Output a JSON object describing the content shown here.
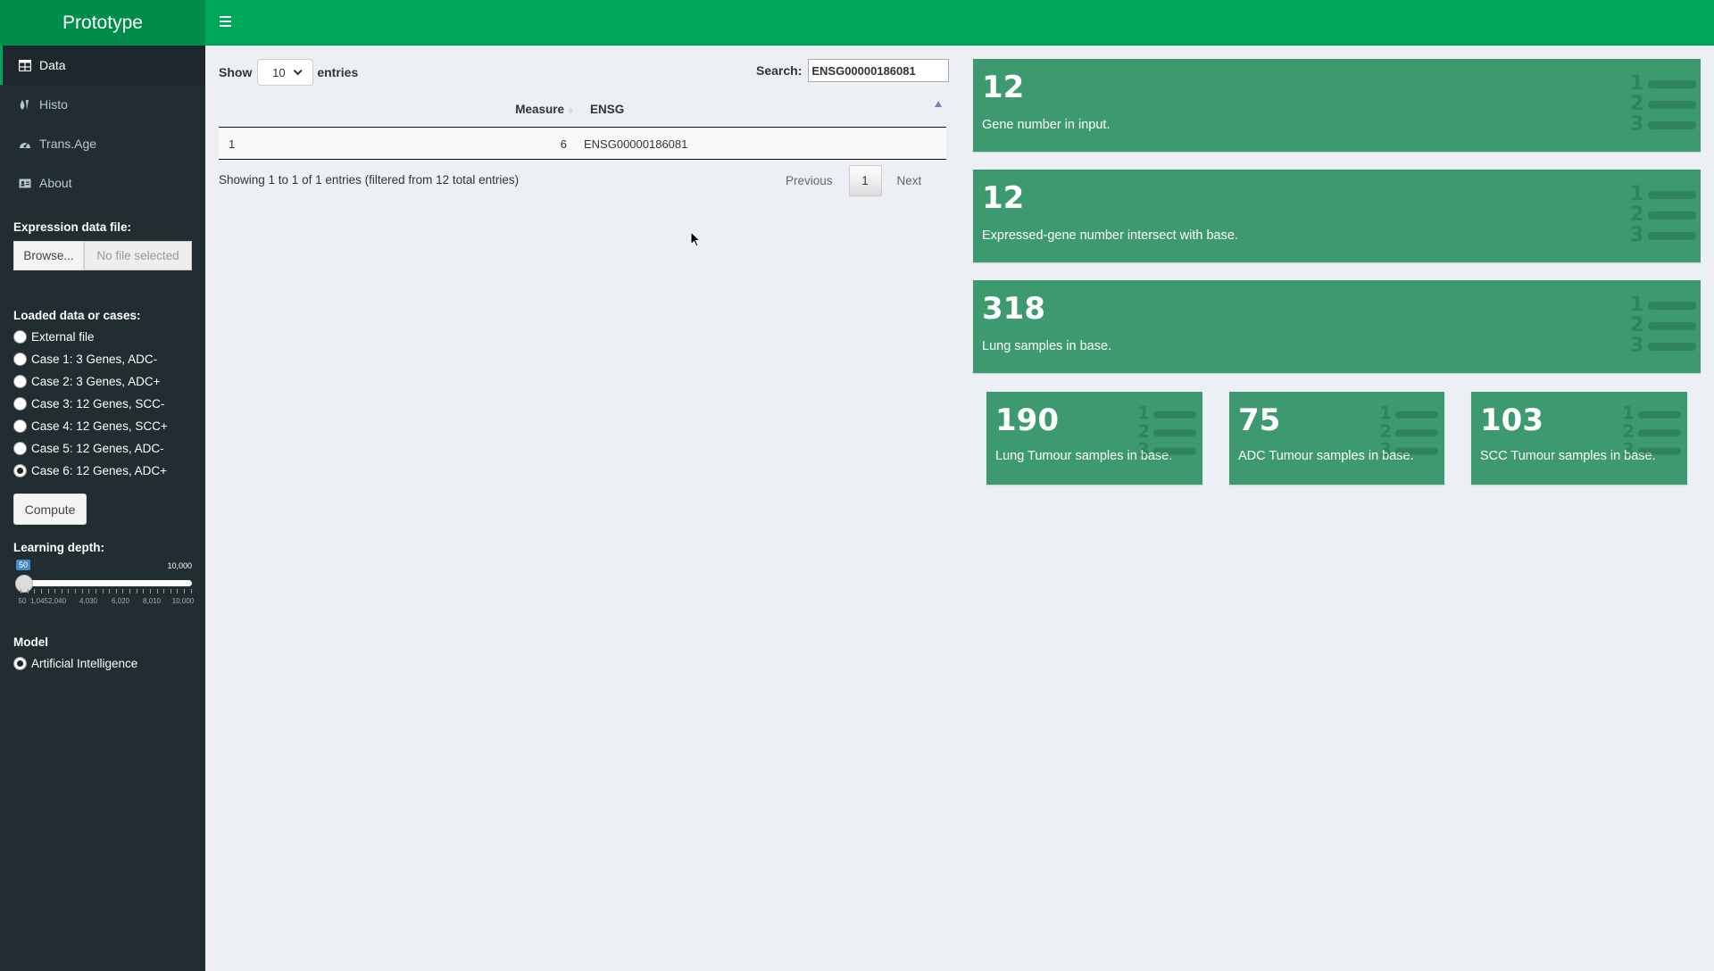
{
  "app": {
    "title": "Prototype"
  },
  "sidebar": {
    "menu": [
      {
        "label": "Data",
        "icon": "table-icon"
      },
      {
        "label": "Histo",
        "icon": "tint-icon"
      },
      {
        "label": "Trans.Age",
        "icon": "dashboard-icon"
      },
      {
        "label": "About",
        "icon": "id-card-icon"
      }
    ],
    "file_input": {
      "label": "Expression data file:",
      "button": "Browse...",
      "placeholder": "No file selected"
    },
    "cases": {
      "label": "Loaded data or cases:",
      "options": [
        "External file",
        "Case 1: 3 Genes, ADC-",
        "Case 2: 3 Genes, ADC+",
        "Case 3: 12 Genes, SCC-",
        "Case 4: 12 Genes, SCC+",
        "Case 5: 12 Genes, ADC-",
        "Case 6: 12 Genes, ADC+"
      ],
      "selected": "Case 6: 12 Genes, ADC+"
    },
    "compute_label": "Compute",
    "learning_depth": {
      "label": "Learning depth:",
      "value": "50",
      "max_label": "10,000",
      "tick_labels": [
        "50",
        "1,0452,040",
        "4,030",
        "6,020",
        "8,010",
        "10,000"
      ]
    },
    "model": {
      "label": "Model",
      "options": [
        "Artificial Intelligence"
      ],
      "selected": "Artificial Intelligence"
    }
  },
  "table": {
    "show_label": "Show",
    "length_value": "10",
    "entries_label": "entries",
    "search_label": "Search:",
    "search_value": "ENSG00000186081",
    "columns": [
      "",
      "Measure",
      "ENSG"
    ],
    "rows": [
      [
        "1",
        "6",
        "ENSG00000186081"
      ]
    ],
    "info": "Showing 1 to 1 of 1 entries (filtered from 12 total entries)",
    "pagination": {
      "previous": "Previous",
      "current": "1",
      "next": "Next"
    }
  },
  "value_boxes": [
    {
      "value": "12",
      "caption": "Gene number in input.",
      "icon": "list-ol-icon"
    },
    {
      "value": "12",
      "caption": "Expressed-gene number intersect with base.",
      "icon": "list-ol-icon"
    },
    {
      "value": "318",
      "caption": "Lung samples in base.",
      "icon": "list-ol-icon"
    },
    {
      "value": "190",
      "caption": "Lung Tumour samples in base.",
      "icon": "list-ol-icon"
    },
    {
      "value": "75",
      "caption": "ADC Tumour samples in base.",
      "icon": "list-ol-icon"
    },
    {
      "value": "103",
      "caption": "SCC Tumour samples in base.",
      "icon": "list-ol-icon"
    }
  ],
  "colors": {
    "header": "#00a65a",
    "logo": "#008d4c",
    "sidebar": "#222d32",
    "box": "#3d9970",
    "content": "#ecf0f5"
  }
}
